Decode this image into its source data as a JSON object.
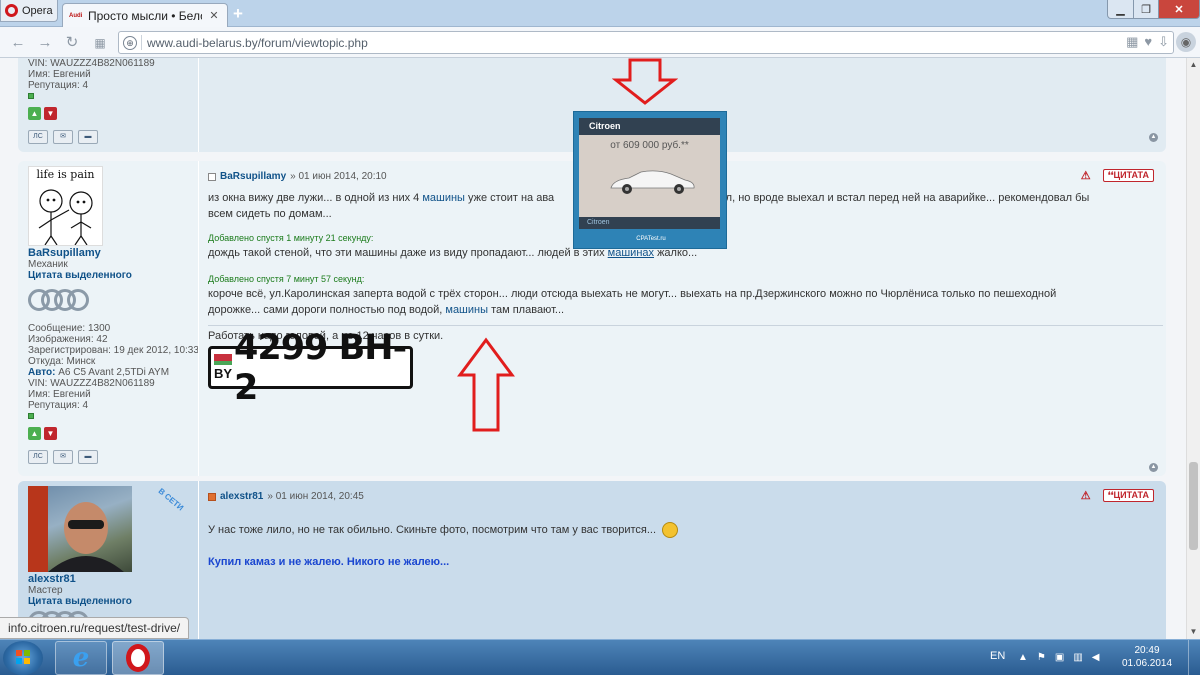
{
  "browser": {
    "menu_label": "Opera",
    "tab_title": "Просто мысли • Белорус",
    "tab_favicon": "Audi",
    "address": "www.audi-belarus.by/forum/viewtopic.php",
    "status_url": "info.citroen.ru/request/test-drive/"
  },
  "posts": [
    {
      "profile": {
        "vin_label": "VIN:",
        "vin": "WAUZZZ4B82N061189",
        "name_label": "Имя:",
        "name_value": "Евгений",
        "rep_label": "Репутация:",
        "rep_value": "4"
      }
    },
    {
      "avatar_text": "life is pain",
      "username": "BaRsupillamy",
      "rank": "Механик",
      "quote_link": "Цитата выделенного",
      "stats": {
        "msgs_label": "Сообщение:",
        "msgs": "1300",
        "imgs_label": "Изображения:",
        "imgs": "42",
        "reg_label": "Зарегистрирован:",
        "reg": "19 дек 2012, 10:33",
        "from_label": "Откуда:",
        "from": "Минск",
        "car_label": "Авто:",
        "car": "A6 C5 Avant 2,5TDi AYM",
        "vin_label": "VIN:",
        "vin": "WAUZZZ4B82N061189",
        "name_label": "Имя:",
        "name_value": "Евгений",
        "rep_label": "Репутация:",
        "rep_value": "4"
      },
      "header_author": "BaRsupillamy",
      "header_date": "» 01 июн 2014, 20:10",
      "body1_a": "из окна вижу две лужи... в одной из них 4",
      "body1_link": "машины",
      "body1_b": "уже стоит на ава",
      "body1_c": "аехал, но вроде выехал и встал перед ней на аварийке... рекомендовал бы",
      "body1_d": "всем сидеть по домам...",
      "added1": "Добавлено спустя 1 минуту 21 секунду:",
      "body2_a": "дождь такой стеной, что эти машины даже из виду пропадают... людей в этих",
      "body2_link": "машинах",
      "body2_b": "жалко...",
      "added2": "Добавлено спустя 7 минут 57 секунд:",
      "body3_a": "короче всё, ул.Каролинская заперта водой с трёх сторон... люди отсюда выехать не могут... выехать на пр.Дзержинского можно по Чюрлёниса только по пешеходной",
      "body3_b": "дорожке... сами дороги полностью под водой,",
      "body3_link": "машины",
      "body3_c": "там плавают...",
      "signature": "Работать надо головой, а не 12 часов в сутки.",
      "plate_country": "BY",
      "plate_number": "4299 BH-2",
      "quote_btn": "ЦИТАТА"
    },
    {
      "username": "alexstr81",
      "online": "В СЕТИ",
      "rank": "Мастер",
      "quote_link": "Цитата выделенного",
      "header_author": "alexstr81",
      "header_date": "» 01 июн 2014, 20:45",
      "body": "У нас тоже лило, но не так обильно. Скиньте фото, посмотрим что там у вас творится...",
      "signature": "Купил камаз и не жалею. Никого не жалею...",
      "quote_btn": "ЦИТАТА"
    }
  ],
  "ad": {
    "brand": "Citroen",
    "price": "от 609 000 руб.**",
    "footer_brand": "Citroen",
    "source": "CPATest.ru"
  },
  "taskbar": {
    "lang": "EN",
    "time": "20:49",
    "date": "01.06.2014"
  },
  "colors": {
    "link": "#105289",
    "accent_red": "#c0262d",
    "arrow_red": "#e11d1d"
  }
}
